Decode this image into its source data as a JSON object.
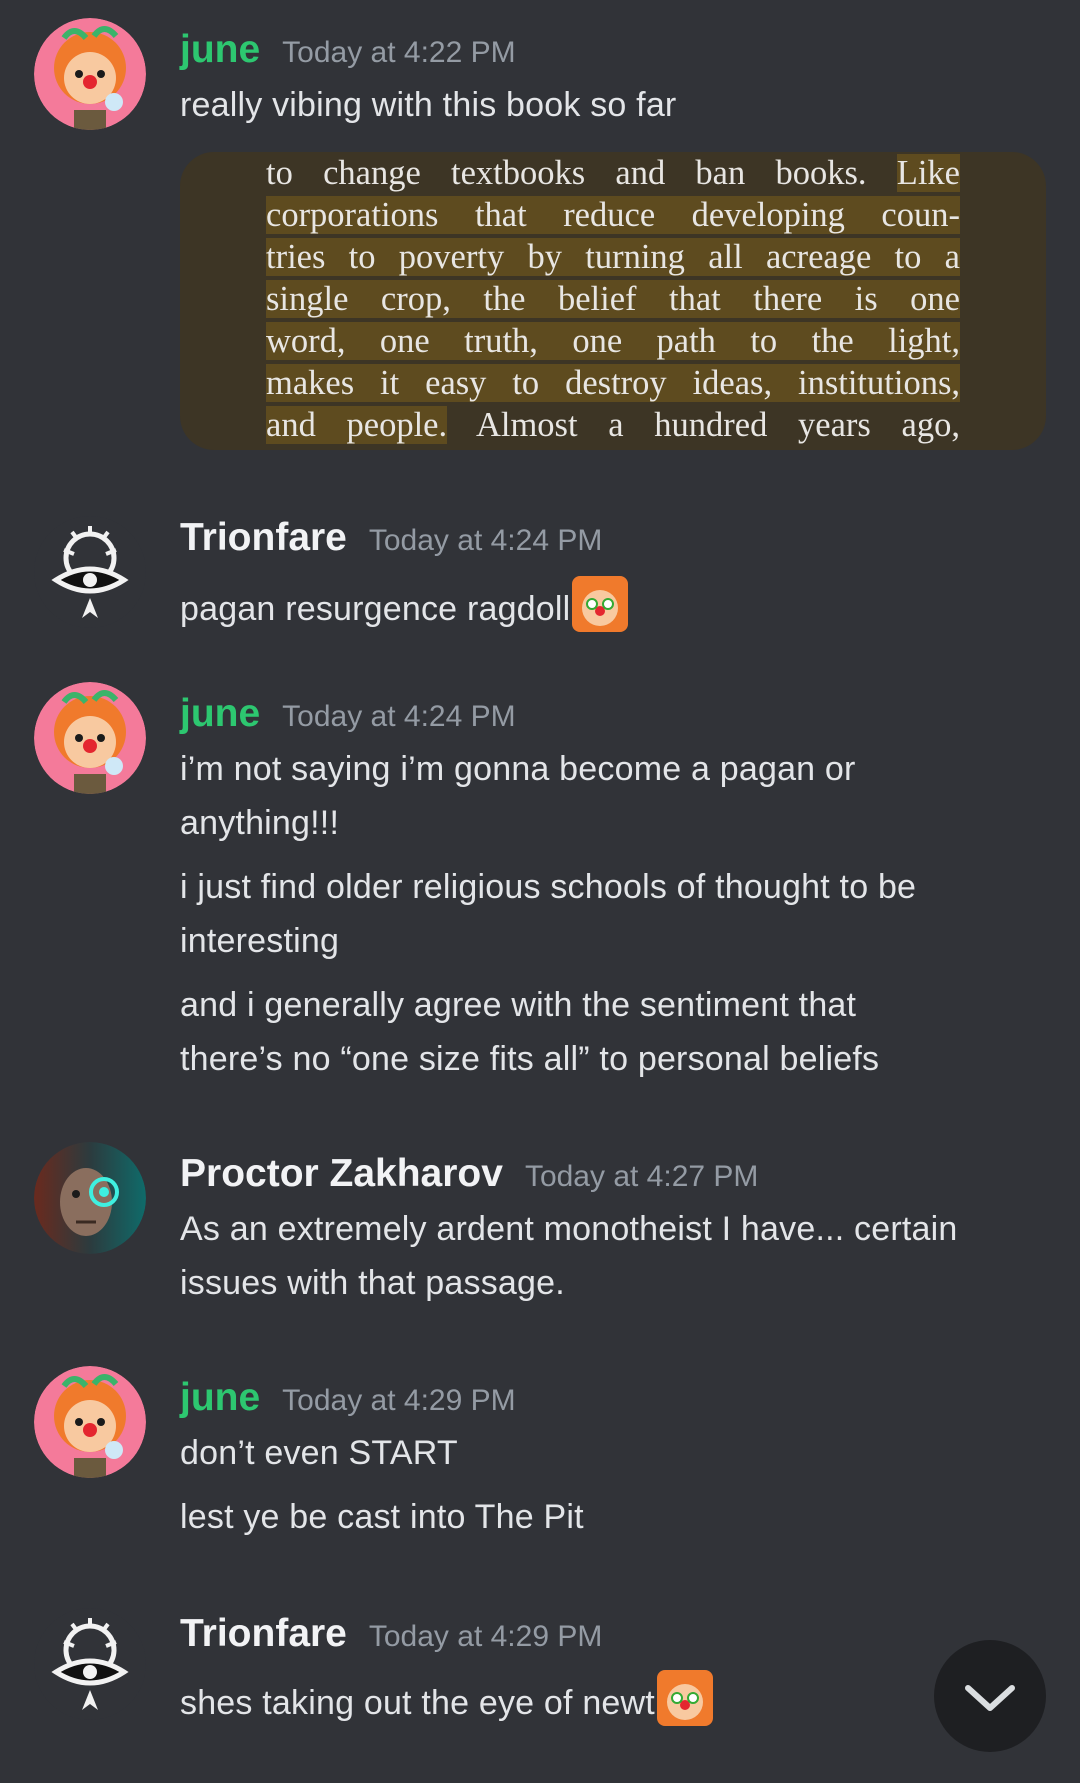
{
  "messages": [
    {
      "author": "june",
      "timestamp": "Today at 4:22 PM",
      "lines": [
        "really vibing with this book so far"
      ],
      "attachment_lines": [
        [
          "to change textbooks and ban books. ",
          "Like"
        ],
        [
          "corporations that reduce developing coun-"
        ],
        [
          "tries to poverty by turning all acreage to a"
        ],
        [
          "single crop, the belief that there is one"
        ],
        [
          "word, one truth, one path to the light,"
        ],
        [
          "makes it easy to destroy ideas, institutions,"
        ],
        [
          "and people.",
          " Almost a hundred years ago,"
        ]
      ]
    },
    {
      "author": "Trionfare",
      "timestamp": "Today at 4:24 PM",
      "lines": [
        "pagan resurgence ragdoll"
      ]
    },
    {
      "author": "june",
      "timestamp": "Today at 4:24 PM",
      "lines": [
        "i’m not saying i’m gonna become a pagan or",
        "anything!!!",
        "i just find older religious schools of thought to be",
        "interesting",
        "and i generally agree with the sentiment that",
        "there’s no “one size fits all” to personal beliefs"
      ]
    },
    {
      "author": "Proctor Zakharov",
      "timestamp": "Today at 4:27 PM",
      "lines": [
        "As an extremely ardent monotheist I have... certain",
        "issues with that passage."
      ]
    },
    {
      "author": "june",
      "timestamp": "Today at 4:29 PM",
      "lines": [
        "don’t even START",
        "lest ye be cast into The Pit"
      ]
    },
    {
      "author": "Trionfare",
      "timestamp": "Today at 4:29 PM",
      "lines": [
        "shes taking out the eye of newt"
      ]
    }
  ],
  "colors": {
    "june": "#2dc770",
    "background": "#313338",
    "highlight": "#5e4b1f"
  },
  "icons": {
    "scroll_button": "chevron-down-icon",
    "emoji": "clown-emoji-icon"
  }
}
